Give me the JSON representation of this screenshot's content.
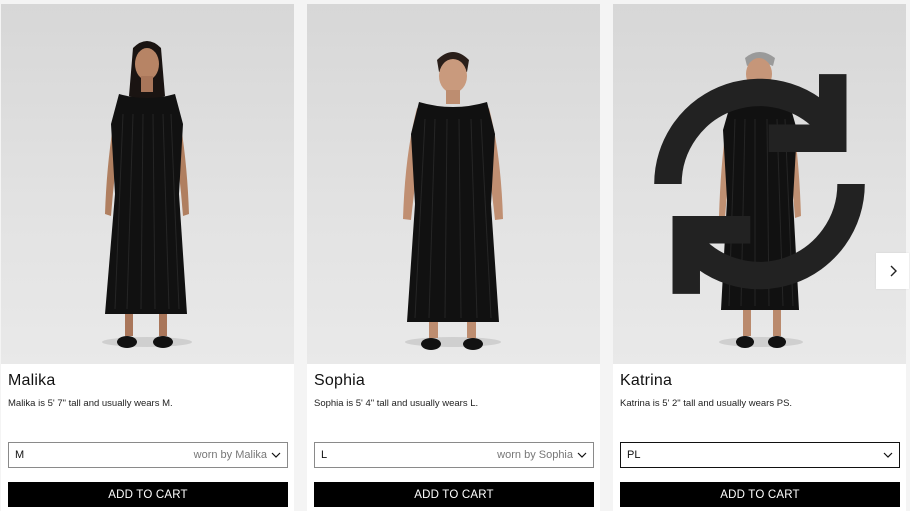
{
  "models": [
    {
      "name": "Malika",
      "description": "Malika is 5' 7\" tall and usually wears M.",
      "size": "M",
      "worn_by": "worn by Malika",
      "cart_label": "ADD TO CART"
    },
    {
      "name": "Sophia",
      "description": "Sophia is 5' 4\" tall and usually wears L.",
      "size": "L",
      "worn_by": "worn by Sophia",
      "cart_label": "ADD TO CART"
    },
    {
      "name": "Katrina",
      "description": "Katrina is 5' 2\" tall and usually wears PS.",
      "size": "PL",
      "worn_by": "",
      "cart_label": "ADD TO CART"
    }
  ],
  "icons": {
    "next": "chevron-right-icon",
    "rotate": "rotate-icon",
    "dropdown": "chevron-down-icon"
  },
  "colors": {
    "button_bg": "#000000",
    "button_text": "#ffffff",
    "dress": "#111111"
  }
}
